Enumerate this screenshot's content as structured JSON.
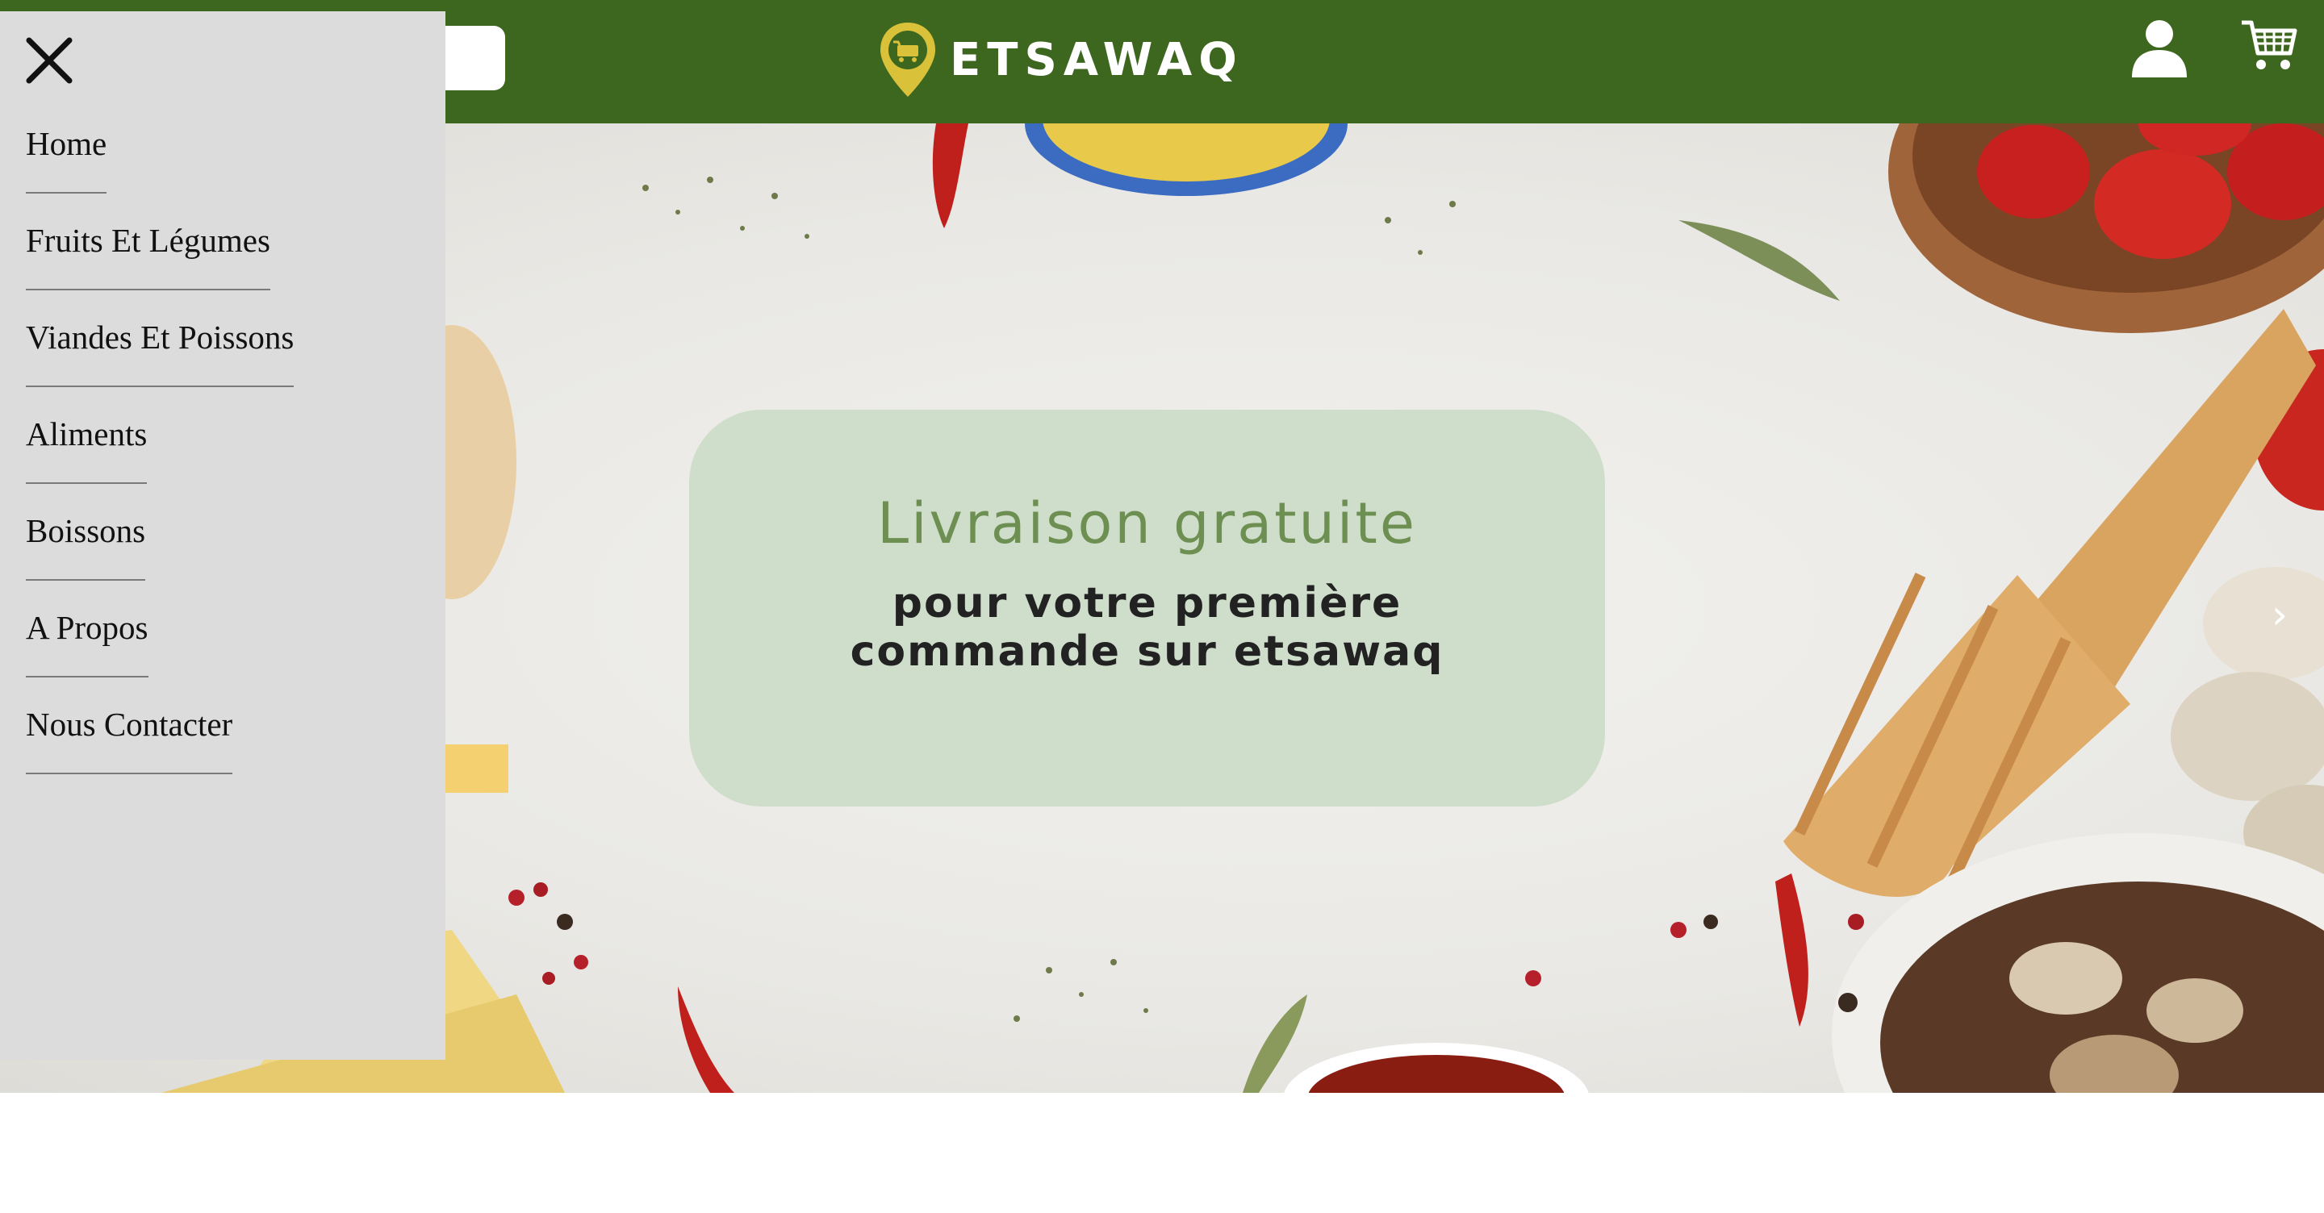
{
  "header": {
    "brand": "ETSAWAQ",
    "background_color": "#3d661f",
    "icons": [
      "user-icon",
      "cart-icon",
      "logo-pin-icon"
    ]
  },
  "drawer": {
    "close_icon": "close-icon",
    "items": [
      {
        "label": "Home"
      },
      {
        "label": "Fruits Et Légumes"
      },
      {
        "label": "Viandes Et Poissons"
      },
      {
        "label": "Aliments"
      },
      {
        "label": "Boissons"
      },
      {
        "label": "A Propos"
      },
      {
        "label": "Nous Contacter"
      }
    ]
  },
  "hero": {
    "promo_title": "Livraison gratuite",
    "promo_line1": "pour votre première",
    "promo_line2": "commande sur etsawaq",
    "card_color": "#cfdecb",
    "title_color": "#6d8f52",
    "next_icon": "chevron-right-icon"
  }
}
